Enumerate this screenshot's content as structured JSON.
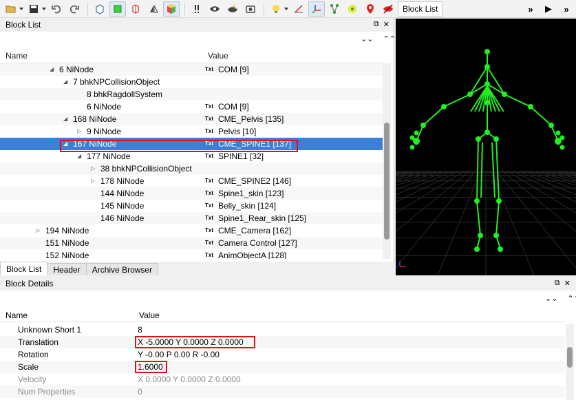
{
  "toolbar": {
    "block_list_label": "Block List",
    "more_label": "»",
    "play_label": "▶",
    "overflow_label": "»"
  },
  "block_list": {
    "title": "Block List",
    "columns": {
      "name": "Name",
      "value": "Value"
    },
    "rows": [
      {
        "name": "6 NiNode",
        "value": "COM [9]",
        "indent": 86,
        "arrow": "expanded",
        "tag": "Txt"
      },
      {
        "name": "7 bhkNPCollisionObject",
        "value": "",
        "indent": 106,
        "arrow": "expanded",
        "tag": ""
      },
      {
        "name": "8 bhkRagdollSystem",
        "value": "",
        "indent": 126,
        "arrow": "none",
        "tag": ""
      },
      {
        "name": "6 NiNode",
        "value": "COM [9]",
        "indent": 126,
        "arrow": "none",
        "tag": "Txt"
      },
      {
        "name": "168 NiNode",
        "value": "CME_Pelvis [135]",
        "indent": 106,
        "arrow": "expanded",
        "tag": "Txt"
      },
      {
        "name": "9 NiNode",
        "value": "Pelvis [10]",
        "indent": 126,
        "arrow": "collapsed",
        "tag": "Txt"
      },
      {
        "name": "167 NiNode",
        "value": "CME_SPINE1 [137]",
        "indent": 106,
        "arrow": "expanded",
        "tag": "Txt",
        "selected": true
      },
      {
        "name": "177 NiNode",
        "value": "SPINE1 [32]",
        "indent": 126,
        "arrow": "expanded",
        "tag": "Txt"
      },
      {
        "name": "38 bhkNPCollisionObject",
        "value": "",
        "indent": 146,
        "arrow": "collapsed",
        "tag": ""
      },
      {
        "name": "178 NiNode",
        "value": "CME_SPINE2 [146]",
        "indent": 146,
        "arrow": "collapsed",
        "tag": "Txt"
      },
      {
        "name": "144 NiNode",
        "value": "Spine1_skin [123]",
        "indent": 146,
        "arrow": "none",
        "tag": "Txt"
      },
      {
        "name": "145 NiNode",
        "value": "Belly_skin [124]",
        "indent": 146,
        "arrow": "none",
        "tag": "Txt"
      },
      {
        "name": "146 NiNode",
        "value": "Spine1_Rear_skin [125]",
        "indent": 146,
        "arrow": "none",
        "tag": "Txt"
      },
      {
        "name": "194 NiNode",
        "value": "CME_Camera [162]",
        "indent": 66,
        "arrow": "collapsed",
        "tag": "Txt"
      },
      {
        "name": "151 NiNode",
        "value": "Camera Control [127]",
        "indent": 66,
        "arrow": "none",
        "tag": "Txt"
      },
      {
        "name": "152 NiNode",
        "value": "AnimObjectA [128]",
        "indent": 66,
        "arrow": "none",
        "tag": "Txt"
      }
    ]
  },
  "tabs": [
    {
      "label": "Block List",
      "active": true
    },
    {
      "label": "Header",
      "active": false
    },
    {
      "label": "Archive Browser",
      "active": false
    }
  ],
  "block_details": {
    "title": "Block Details",
    "columns": {
      "name": "Name",
      "value": "Value"
    },
    "rows": [
      {
        "name": "Unknown Short 1",
        "value": "8",
        "dim": false
      },
      {
        "name": "Translation",
        "value": "X -5.0000 Y 0.0000 Z 0.0000",
        "dim": false
      },
      {
        "name": "Rotation",
        "value": "Y -0.00 P 0.00 R -0.00",
        "dim": false
      },
      {
        "name": "Scale",
        "value": "1.6000",
        "dim": false
      },
      {
        "name": "Velocity",
        "value": "X 0.0000 Y 0.0000 Z 0.0000",
        "dim": true
      },
      {
        "name": "Num Properties",
        "value": "0",
        "dim": true
      }
    ]
  },
  "colors": {
    "selection": "#3c7fd6",
    "highlight_box": "#e01010",
    "skeleton": "#22ee22",
    "viewport_bg": "#000000"
  }
}
